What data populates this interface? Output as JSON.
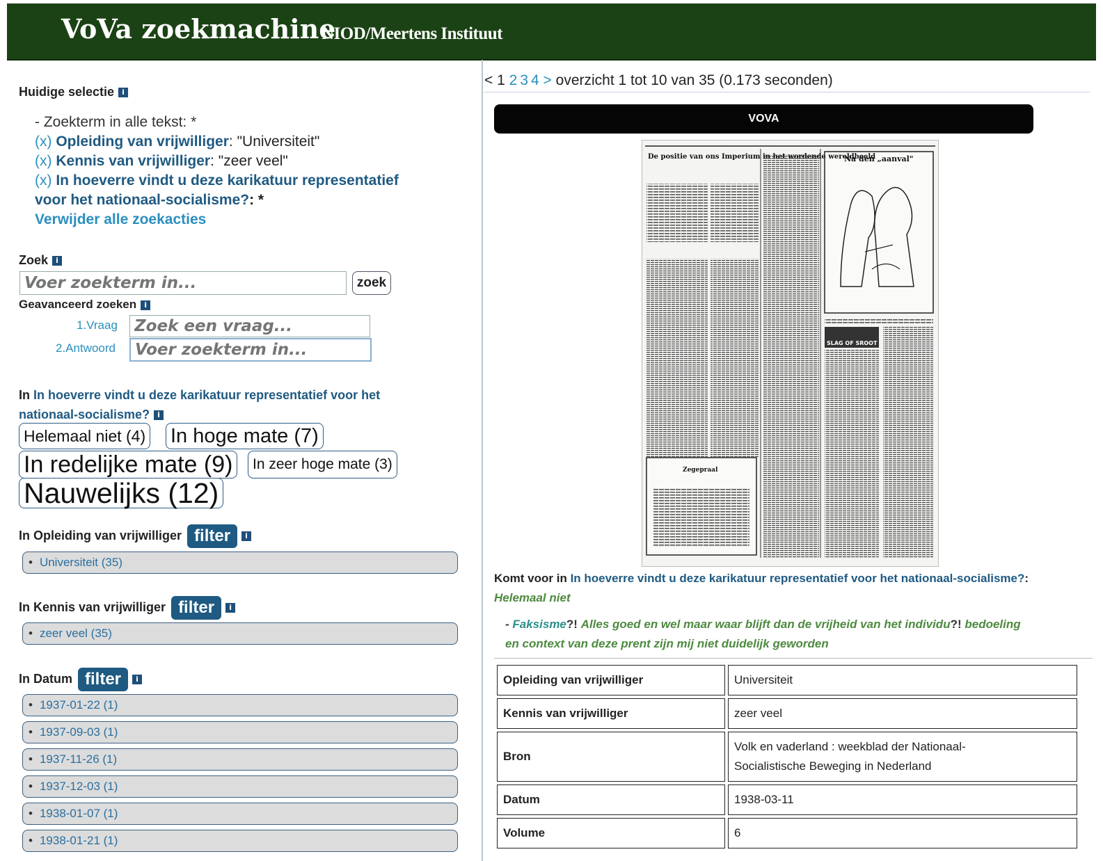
{
  "header": {
    "title": "VoVa zoekmachine",
    "subtitle": "NIOD/Meertens Instituut"
  },
  "selection": {
    "heading": "Huidige selectie",
    "search_term_line": "- Zoekterm in alle tekst: *",
    "filters": [
      {
        "remove": "(x)",
        "field": "Opleiding van vrijwilliger",
        "value": ": \"Universiteit\""
      },
      {
        "remove": "(x)",
        "field": "Kennis van vrijwilliger",
        "value": ": \"zeer veel\""
      },
      {
        "remove": "(x)",
        "field": "In hoeverre vindt u deze karikatuur representatief",
        "field2": "voor het nationaal-socialisme?",
        "value": ": *"
      }
    ],
    "remove_all": "Verwijder alle zoekacties"
  },
  "search": {
    "heading": "Zoek",
    "placeholder": "Voer zoekterm in...",
    "button": "zoek",
    "advanced_heading": "Geavanceerd zoeken",
    "question_label": "1.Vraag",
    "question_placeholder": "Zoek een vraag...",
    "answer_label": "2.Antwoord",
    "answer_placeholder": "Voer zoekterm in..."
  },
  "question_facet": {
    "heading_prefix": "In ",
    "heading_link": "In hoeverre vindt u deze karikatuur representatief voor het",
    "heading_link2": "nationaal-socialisme?",
    "chips": [
      "Helemaal niet (4)",
      "In hoge mate (7)",
      "In redelijke mate (9)",
      "In zeer hoge mate (3)",
      "Nauwelijks (12)"
    ]
  },
  "facets": {
    "filter_label": "filter",
    "opleiding": {
      "heading": "In Opleiding van vrijwilliger",
      "items": [
        "Universiteit (35)"
      ]
    },
    "kennis": {
      "heading": "In Kennis van vrijwilliger",
      "items": [
        "zeer veel (35)"
      ]
    },
    "datum": {
      "heading": "In Datum",
      "items": [
        "1937-01-22 (1)",
        "1937-09-03 (1)",
        "1937-11-26 (1)",
        "1937-12-03 (1)",
        "1938-01-07 (1)",
        "1938-01-21 (1)"
      ]
    }
  },
  "results": {
    "pager": {
      "prev": "<",
      "current": "1",
      "pages": [
        "2",
        "3",
        "4"
      ],
      "next": ">",
      "summary": "overzicht 1 tot 10 van 35 (0.173 seconden)"
    },
    "item": {
      "source_label": "VOVA",
      "newspaper": {
        "headline_left": "De positie van ons Imperium in het wordende wereldbeeld",
        "headline_right": "Na den „aanval\"",
        "box_title": "Zegepraal",
        "small_head": "SLAG OF SROOT"
      },
      "komt_prefix": "Komt voor in ",
      "komt_link": "In hoeverre vindt u deze karikatuur representatief voor het nationaal-socialisme?",
      "komt_suffix": ":",
      "komt_value": "Helemaal niet",
      "quote_dash": "- ",
      "quote_word": "Faksisme",
      "quote_mid": "?! ",
      "quote_rest1": "Alles goed en wel maar waar blijft dan de vrijheid van het individu",
      "quote_mid2": "?! ",
      "quote_rest2": "bedoeling",
      "quote_line2": "en context van deze prent zijn mij niet duidelijk geworden",
      "properties": [
        {
          "key": "Opleiding van vrijwilliger",
          "value": "Universiteit"
        },
        {
          "key": "Kennis van vrijwilliger",
          "value": "zeer veel"
        },
        {
          "key": "Bron",
          "value": "Volk en vaderland : weekblad der Nationaal-",
          "value2": "Socialistische Beweging in Nederland"
        },
        {
          "key": "Datum",
          "value": "1938-03-11"
        },
        {
          "key": "Volume",
          "value": "6"
        }
      ]
    }
  },
  "colors": {
    "header_bg": "#1b4214",
    "link": "#2a8fbf",
    "filter_bg": "#1f5a82",
    "quote": "#4d8a3f"
  }
}
